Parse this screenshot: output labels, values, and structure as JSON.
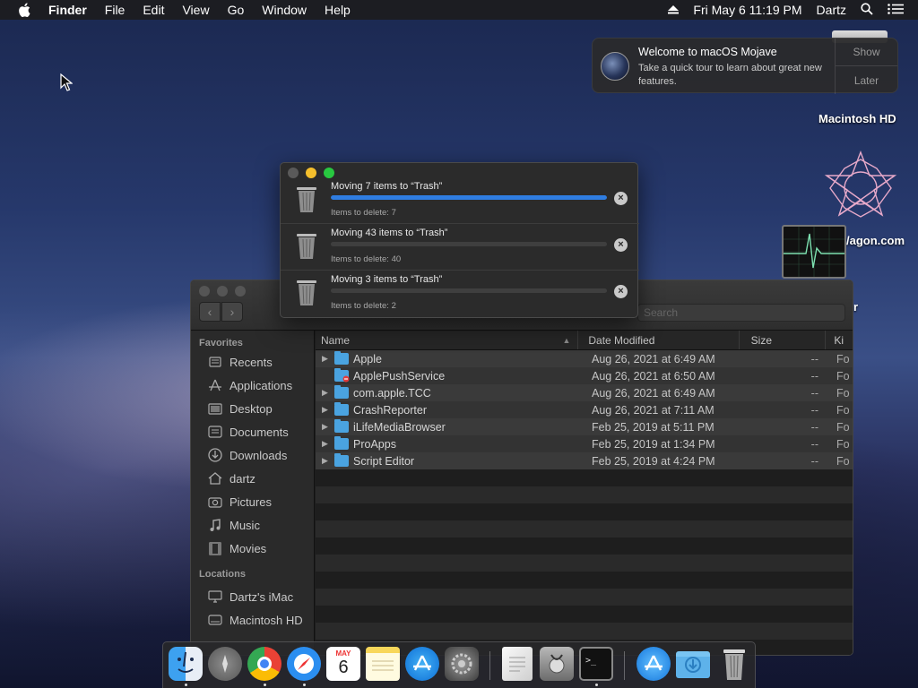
{
  "menubar": {
    "app": "Finder",
    "items": [
      "File",
      "Edit",
      "View",
      "Go",
      "Window",
      "Help"
    ],
    "clock": "Fri May 6  11:19 PM",
    "user": "Dartz",
    "icons": [
      "apple-logo-icon",
      "eject-icon",
      "spotlight-search-icon",
      "notification-center-icon"
    ]
  },
  "notification": {
    "title": "Welcome to macOS Mojave",
    "body": "Take a quick tour to learn about great new features.",
    "show_label": "Show",
    "later_label": "Later",
    "icon": "mojave-icon"
  },
  "desktop": {
    "icons": [
      {
        "label": "Macintosh HD",
        "icon": "hard-drive-icon"
      },
      {
        "label": "/agon.com",
        "icon": "star-polygon-icon"
      },
      {
        "label": "r",
        "icon": "activity-monitor-icon"
      }
    ]
  },
  "copy_progress": {
    "tasks": [
      {
        "title": "Moving 7 items to “Trash”",
        "subtitle": "Items to delete: 7",
        "progress": 1.0
      },
      {
        "title": "Moving 43 items to “Trash”",
        "subtitle": "Items to delete: 40",
        "progress": 0.0
      },
      {
        "title": "Moving 3 items to “Trash”",
        "subtitle": "Items to delete: 2",
        "progress": 0.0
      }
    ]
  },
  "finder": {
    "search_placeholder": "Search",
    "sidebar": {
      "favorites_header": "Favorites",
      "favorites": [
        {
          "label": "Recents",
          "icon": "recents-icon"
        },
        {
          "label": "Applications",
          "icon": "applications-icon"
        },
        {
          "label": "Desktop",
          "icon": "desktop-icon"
        },
        {
          "label": "Documents",
          "icon": "documents-icon"
        },
        {
          "label": "Downloads",
          "icon": "downloads-icon"
        },
        {
          "label": "dartz",
          "icon": "home-icon"
        },
        {
          "label": "Pictures",
          "icon": "pictures-icon"
        },
        {
          "label": "Music",
          "icon": "music-icon"
        },
        {
          "label": "Movies",
          "icon": "movies-icon"
        }
      ],
      "locations_header": "Locations",
      "locations": [
        {
          "label": "Dartz's iMac",
          "icon": "imac-icon"
        },
        {
          "label": "Macintosh HD",
          "icon": "disk-icon"
        }
      ]
    },
    "columns": {
      "name": "Name",
      "date": "Date Modified",
      "size": "Size",
      "kind": "Ki"
    },
    "rows": [
      {
        "name": "Apple",
        "date": "Aug 26, 2021 at 6:49 AM",
        "size": "--",
        "kind": "Fo",
        "expandable": true
      },
      {
        "name": "ApplePushService",
        "date": "Aug 26, 2021 at 6:50 AM",
        "size": "--",
        "kind": "Fo",
        "expandable": false
      },
      {
        "name": "com.apple.TCC",
        "date": "Aug 26, 2021 at 6:49 AM",
        "size": "--",
        "kind": "Fo",
        "expandable": true
      },
      {
        "name": "CrashReporter",
        "date": "Aug 26, 2021 at 7:11 AM",
        "size": "--",
        "kind": "Fo",
        "expandable": true
      },
      {
        "name": "iLifeMediaBrowser",
        "date": "Feb 25, 2019 at 5:11 PM",
        "size": "--",
        "kind": "Fo",
        "expandable": true
      },
      {
        "name": "ProApps",
        "date": "Feb 25, 2019 at 1:34 PM",
        "size": "--",
        "kind": "Fo",
        "expandable": true
      },
      {
        "name": "Script Editor",
        "date": "Feb 25, 2019 at 4:24 PM",
        "size": "--",
        "kind": "Fo",
        "expandable": true
      }
    ]
  },
  "dock": {
    "items": [
      {
        "name": "finder-dock-icon",
        "running": true
      },
      {
        "name": "launchpad-dock-icon",
        "running": false
      },
      {
        "name": "chrome-dock-icon",
        "running": true
      },
      {
        "name": "safari-dock-icon",
        "running": true
      },
      {
        "name": "calendar-dock-icon",
        "running": false,
        "month": "MAY",
        "day": "6"
      },
      {
        "name": "notes-dock-icon",
        "running": false
      },
      {
        "name": "app-store-dock-icon",
        "running": false
      },
      {
        "name": "system-preferences-dock-icon",
        "running": false
      },
      {
        "name": "textedit-dock-icon",
        "running": false
      },
      {
        "name": "disk-utility-dock-icon",
        "running": false
      },
      {
        "name": "terminal-dock-icon",
        "running": true
      },
      {
        "name": "applications-folder-dock-icon",
        "running": false
      },
      {
        "name": "downloads-folder-dock-icon",
        "running": false
      },
      {
        "name": "trash-dock-icon",
        "running": false
      }
    ]
  },
  "colors": {
    "accent": "#2f7de1",
    "folder": "#4aa3e0"
  }
}
